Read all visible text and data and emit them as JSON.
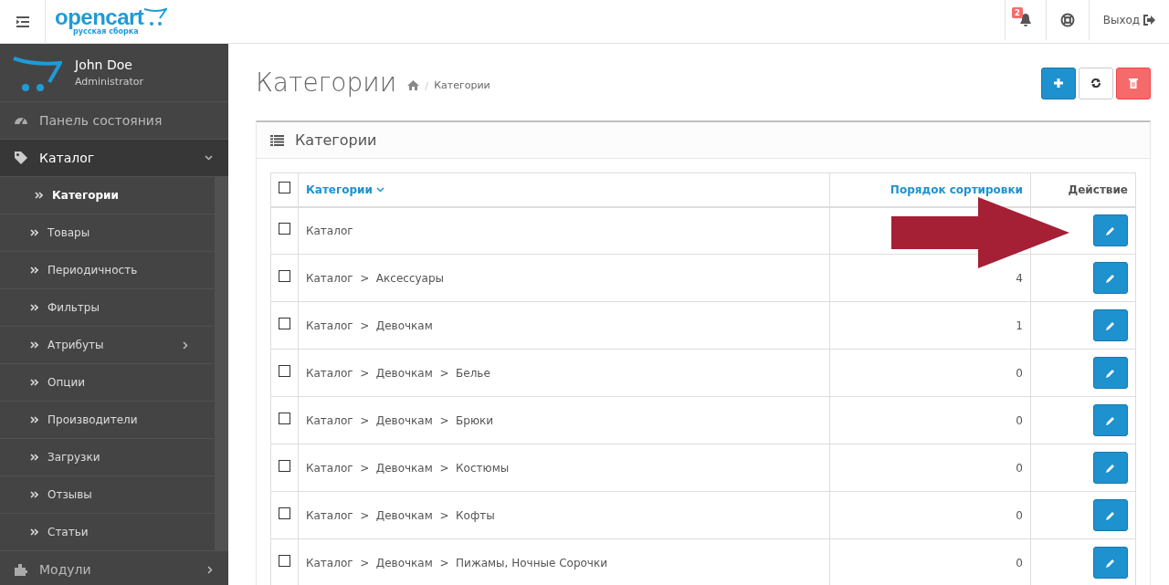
{
  "header": {
    "logo_text": "opencart",
    "logo_subtitle": "русская сборка",
    "notification_count": "2",
    "logout_label": "Выход"
  },
  "user": {
    "name": "John Doe",
    "role": "Administrator"
  },
  "sidebar": {
    "items": [
      {
        "label": "Панель состояния",
        "kind": "dashboard",
        "expanded": false,
        "has_children": false
      },
      {
        "label": "Каталог",
        "kind": "tag",
        "expanded": true,
        "has_children": true,
        "children": [
          {
            "label": "Категории",
            "selected": true,
            "has_children": false
          },
          {
            "label": "Товары",
            "selected": false,
            "has_children": false
          },
          {
            "label": "Периодичность",
            "selected": false,
            "has_children": false
          },
          {
            "label": "Фильтры",
            "selected": false,
            "has_children": false
          },
          {
            "label": "Атрибуты",
            "selected": false,
            "has_children": true
          },
          {
            "label": "Опции",
            "selected": false,
            "has_children": false
          },
          {
            "label": "Производители",
            "selected": false,
            "has_children": false
          },
          {
            "label": "Загрузки",
            "selected": false,
            "has_children": false
          },
          {
            "label": "Отзывы",
            "selected": false,
            "has_children": false
          },
          {
            "label": "Статьи",
            "selected": false,
            "has_children": false
          }
        ]
      },
      {
        "label": "Модули",
        "kind": "puzzle",
        "expanded": false,
        "has_children": true
      }
    ]
  },
  "page": {
    "title": "Категории",
    "breadcrumb": [
      "Категории"
    ]
  },
  "panel": {
    "title": "Категории"
  },
  "table": {
    "columns": [
      {
        "label": "Категории",
        "kind": "sorted"
      },
      {
        "label": "Порядок сортировки",
        "kind": "link"
      },
      {
        "label": "Действие",
        "kind": "plain"
      }
    ],
    "select_all": false,
    "rows": [
      {
        "name": "Каталог",
        "sort_order": "",
        "checked": false
      },
      {
        "name": "Каталог  >  Аксессуары",
        "sort_order": "4",
        "checked": false
      },
      {
        "name": "Каталог  >  Девочкам",
        "sort_order": "1",
        "checked": false
      },
      {
        "name": "Каталог  >  Девочкам  >  Белье",
        "sort_order": "0",
        "checked": false
      },
      {
        "name": "Каталог  >  Девочкам  >  Брюки",
        "sort_order": "0",
        "checked": false
      },
      {
        "name": "Каталог  >  Девочкам  >  Костюмы",
        "sort_order": "0",
        "checked": false
      },
      {
        "name": "Каталог  >  Девочкам  >  Кофты",
        "sort_order": "0",
        "checked": false
      },
      {
        "name": "Каталог  >  Девочкам  >  Пижамы, Ночные Сорочки",
        "sort_order": "0",
        "checked": false
      }
    ]
  },
  "annotation": {
    "kind": "arrow"
  }
}
